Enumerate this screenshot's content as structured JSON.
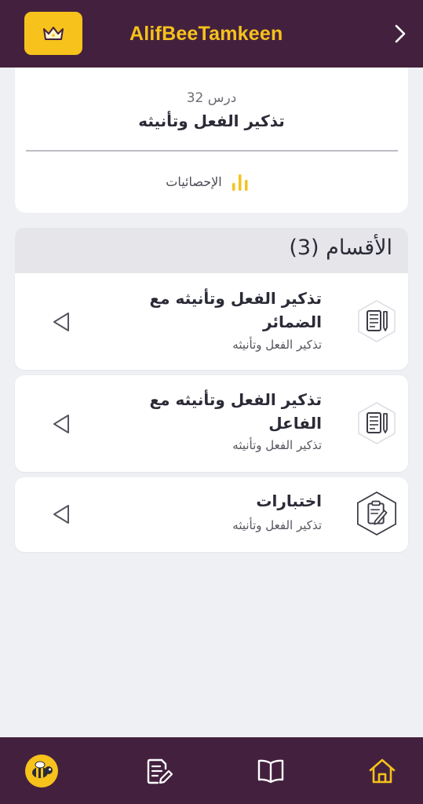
{
  "header": {
    "brand": "AlifBeeTamkeen",
    "crown_icon": "crown-icon",
    "back_icon": "chevron-right-icon",
    "accent_color": "#f6c21b",
    "bar_color": "#43213e"
  },
  "lesson": {
    "number": "درس 32",
    "title": "تذكير الفعل وتأنيثه",
    "stats_label": "الإحصائيات",
    "stats_icon": "bar-chart-icon"
  },
  "sections": {
    "heading": "الأقسام (3)",
    "items": [
      {
        "title": "تذكير الفعل وتأنيثه مع الضمائر",
        "subtitle": "تذكير الفعل وتأنيثه",
        "icon": "notebook-pencil-icon"
      },
      {
        "title": "تذكير الفعل وتأنيثه مع الفاعل",
        "subtitle": "تذكير الفعل وتأنيثه",
        "icon": "notebook-pencil-icon"
      },
      {
        "title": "اختبارات",
        "subtitle": "تذكير الفعل وتأنيثه",
        "icon": "clipboard-pencil-icon"
      }
    ]
  },
  "bottom_nav": {
    "items": [
      {
        "icon": "bee-avatar-icon"
      },
      {
        "icon": "document-edit-icon"
      },
      {
        "icon": "open-book-icon"
      },
      {
        "icon": "home-icon",
        "active": true
      }
    ]
  }
}
